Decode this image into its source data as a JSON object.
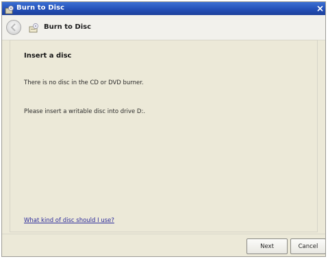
{
  "window": {
    "title": "Burn to Disc",
    "icons": {
      "app": "burn-disc-icon",
      "close": "close-icon"
    }
  },
  "nav": {
    "title": "Burn to Disc",
    "back_icon": "back-arrow-icon",
    "page_icon": "burn-disc-icon"
  },
  "content": {
    "heading": "Insert a disc",
    "line1": "There is no disc in the CD or DVD burner.",
    "line2": "Please insert a writable disc into drive D:.",
    "help_link": "What kind of disc should I use?"
  },
  "footer": {
    "next_label": "Next",
    "cancel_label": "Cancel"
  },
  "colors": {
    "titlebar": "#2450b8",
    "background": "#ece9d8",
    "link": "#2b2a9b"
  }
}
